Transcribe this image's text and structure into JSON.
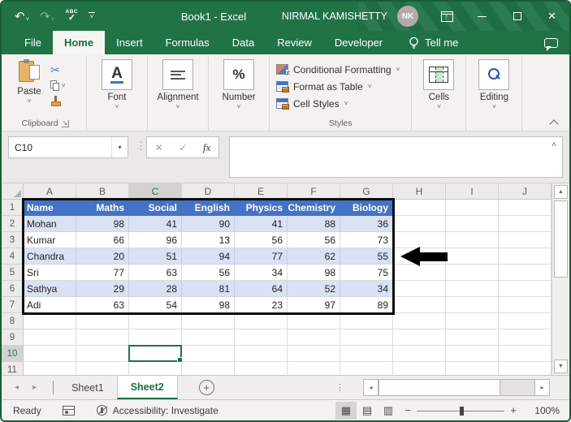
{
  "window": {
    "title": "Book1 - Excel",
    "user_name": "NIRMAL KAMISHETTY",
    "avatar_initials": "NK"
  },
  "ribbon_tabs": [
    {
      "label": "File",
      "active": false
    },
    {
      "label": "Home",
      "active": true
    },
    {
      "label": "Insert",
      "active": false
    },
    {
      "label": "Formulas",
      "active": false
    },
    {
      "label": "Data",
      "active": false
    },
    {
      "label": "Review",
      "active": false
    },
    {
      "label": "Developer",
      "active": false
    }
  ],
  "tell_me_label": "Tell me",
  "ribbon": {
    "paste_label": "Paste",
    "clipboard_group_label": "Clipboard",
    "font_group_label": "Font",
    "alignment_group_label": "Alignment",
    "number_group_label": "Number",
    "conditional_formatting_label": "Conditional Formatting",
    "format_as_table_label": "Format as Table",
    "cell_styles_label": "Cell Styles",
    "styles_group_label": "Styles",
    "cells_group_label": "Cells",
    "editing_group_label": "Editing",
    "font_icon_letter": "A",
    "number_icon_glyph": "%"
  },
  "formula_bar": {
    "name_box_value": "C10",
    "formula_value": ""
  },
  "sheet": {
    "column_letters": [
      "A",
      "B",
      "C",
      "D",
      "E",
      "F",
      "G",
      "H",
      "I",
      "J"
    ],
    "visible_rows": 11,
    "selected_cell": {
      "column": "C",
      "row": 10
    },
    "table": {
      "start_row": 1,
      "headers": [
        "Name",
        "Maths",
        "Social",
        "English",
        "Physics",
        "Chemistry",
        "Biology"
      ],
      "rows": [
        [
          "Mohan",
          98,
          41,
          90,
          41,
          88,
          36
        ],
        [
          "Kumar",
          66,
          96,
          13,
          56,
          56,
          73
        ],
        [
          "Chandra",
          20,
          51,
          94,
          77,
          62,
          55
        ],
        [
          "Sri",
          77,
          63,
          56,
          34,
          98,
          75
        ],
        [
          "Sathya",
          29,
          28,
          81,
          64,
          52,
          34
        ],
        [
          "Adi",
          63,
          54,
          98,
          23,
          97,
          89
        ]
      ],
      "header_bg": "#4472C4",
      "band_bg": "#D9E1F2",
      "outline_color": "#0c0c0c"
    },
    "annotation": {
      "kind": "black-left-arrow",
      "points_at_row": 4
    }
  },
  "sheet_tabs": [
    {
      "label": "Sheet1",
      "active": false
    },
    {
      "label": "Sheet2",
      "active": true
    }
  ],
  "status_bar": {
    "mode": "Ready",
    "accessibility": "Accessibility: Investigate",
    "zoom_level": "100%"
  },
  "icons": {
    "undo": "↶",
    "redo": "↷",
    "spellcheck_text": "ABC",
    "spellcheck_check": "✓",
    "cut": "✂",
    "cancel": "✕",
    "enter": "✓",
    "function": "fx",
    "dropdown": "˅",
    "formula_expand": "˄",
    "namebox_dropdown": "▾",
    "scroll_up": "▲",
    "scroll_down": "▼",
    "scroll_left": "◂",
    "scroll_right": "▸",
    "tab_nav_left": "◂",
    "tab_nav_right": "▸",
    "add_sheet": "+",
    "view_normal": "▦",
    "view_page_layout": "▤",
    "view_page_break": "▥",
    "zoom_out": "−",
    "zoom_in": "+",
    "dots": "⋮",
    "minimize": "−",
    "close": "✕"
  },
  "colors": {
    "brand_green": "#217346",
    "window_border": "#185c37",
    "active_sheet_green": "#1d6f42"
  }
}
